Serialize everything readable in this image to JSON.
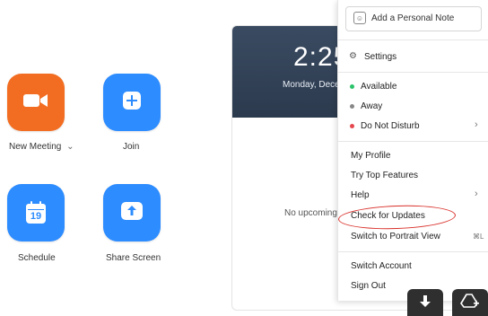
{
  "home": {
    "tiles": [
      {
        "label": "New Meeting",
        "icon": "video-camera-icon"
      },
      {
        "label": "Join",
        "icon": "plus-icon"
      },
      {
        "label": "Schedule",
        "icon": "calendar-icon",
        "day": "19"
      },
      {
        "label": "Share Screen",
        "icon": "share-screen-arrow-icon"
      }
    ],
    "new_meeting_chevron": "⌄"
  },
  "calendar_panel": {
    "time": "2:25",
    "date": "Monday, Dece",
    "empty_text": "No upcoming"
  },
  "menu": {
    "note_placeholder": "Add a Personal Note",
    "settings": "Settings",
    "status": [
      {
        "label": "Available",
        "color": "#2bc36a"
      },
      {
        "label": "Away",
        "color": "#888888"
      },
      {
        "label": "Do Not Disturb",
        "color": "#e5484d",
        "submenu": true
      }
    ],
    "items": [
      {
        "label": "My Profile"
      },
      {
        "label": "Try Top Features"
      },
      {
        "label": "Help",
        "submenu": true
      },
      {
        "label": "Check for Updates"
      },
      {
        "label": "Switch to Portrait View",
        "shortcut": "⌘L"
      }
    ],
    "account_items": [
      {
        "label": "Switch Account"
      },
      {
        "label": "Sign Out"
      }
    ],
    "chevron": "›"
  },
  "colors": {
    "orange": "#f26d21",
    "blue": "#2d8cff",
    "annotation_red": "#d9302a"
  }
}
